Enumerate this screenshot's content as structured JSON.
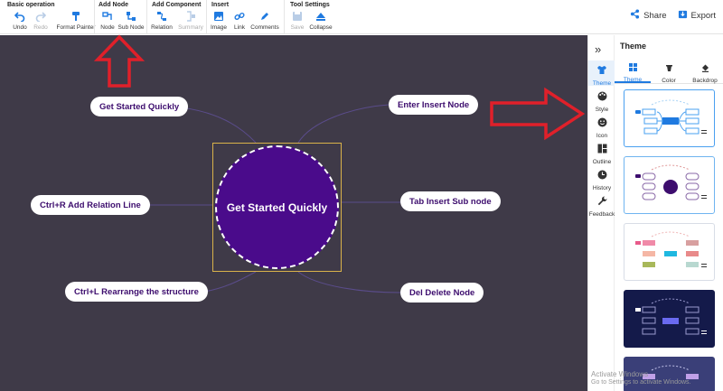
{
  "toolbar": {
    "groups": [
      {
        "title": "Basic operation",
        "buttons": [
          {
            "label": "Undo",
            "icon": "undo-icon"
          },
          {
            "label": "Redo",
            "icon": "redo-icon",
            "disabled": true
          },
          {
            "label": "Format Painter",
            "icon": "format-painter-icon"
          }
        ]
      },
      {
        "title": "Add Node",
        "buttons": [
          {
            "label": "Node",
            "icon": "node-icon"
          },
          {
            "label": "Sub Node",
            "icon": "sub-node-icon"
          }
        ]
      },
      {
        "title": "Add Component",
        "buttons": [
          {
            "label": "Relation",
            "icon": "relation-icon"
          },
          {
            "label": "Summary",
            "icon": "summary-icon",
            "disabled": true
          }
        ]
      },
      {
        "title": "Insert",
        "buttons": [
          {
            "label": "Image",
            "icon": "image-icon"
          },
          {
            "label": "Link",
            "icon": "link-icon"
          },
          {
            "label": "Comments",
            "icon": "comments-icon"
          }
        ]
      },
      {
        "title": "Tool Settings",
        "buttons": [
          {
            "label": "Save",
            "icon": "save-icon",
            "disabled": true
          },
          {
            "label": "Collapse",
            "icon": "collapse-icon"
          }
        ]
      }
    ],
    "share_label": "Share",
    "export_label": "Export"
  },
  "canvas": {
    "center_label": "Get Started Quickly",
    "nodes": [
      "Get Started Quickly",
      "Enter Insert Node",
      "Ctrl+R Add Relation Line",
      "Tab Insert Sub node",
      "Ctrl+L Rearrange the structure",
      "Del Delete Node"
    ]
  },
  "sidebar": {
    "items": [
      {
        "label": "Theme",
        "icon": "shirt-icon",
        "active": true
      },
      {
        "label": "Style",
        "icon": "palette-icon"
      },
      {
        "label": "Icon",
        "icon": "smiley-icon"
      },
      {
        "label": "Outline",
        "icon": "outline-icon"
      },
      {
        "label": "History",
        "icon": "clock-icon"
      },
      {
        "label": "Feedback",
        "icon": "wrench-icon"
      }
    ]
  },
  "panel": {
    "title": "Theme",
    "tabs": [
      {
        "label": "Theme",
        "icon": "grid-icon",
        "active": true
      },
      {
        "label": "Color",
        "icon": "color-bucket-icon"
      },
      {
        "label": "Backdrop",
        "icon": "backdrop-icon"
      }
    ]
  },
  "watermark": {
    "line1": "Activate Windows",
    "line2": "Go to Settings to activate Windows."
  },
  "colors": {
    "accent": "#1f7ae0",
    "canvas_bg": "#3f3a48",
    "center_fill": "#4a0b8b",
    "annotation_arrow": "#e0202a"
  }
}
